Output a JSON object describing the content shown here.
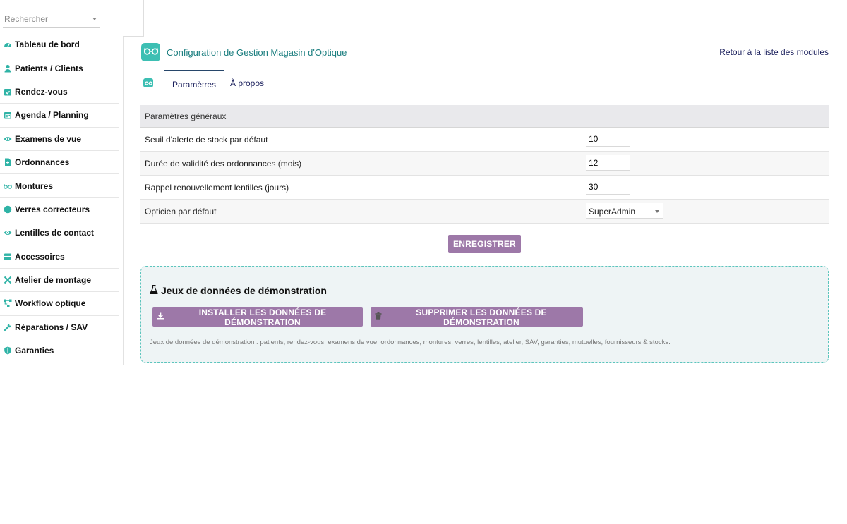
{
  "sidebar": {
    "search_placeholder": "Rechercher",
    "items": [
      {
        "label": "Tableau de bord",
        "icon": "dashboard-icon"
      },
      {
        "label": "Patients / Clients",
        "icon": "user-icon"
      },
      {
        "label": "Rendez-vous",
        "icon": "calendar-check-icon"
      },
      {
        "label": "Agenda / Planning",
        "icon": "calendar-icon"
      },
      {
        "label": "Examens de vue",
        "icon": "eye-icon"
      },
      {
        "label": "Ordonnances",
        "icon": "prescription-file-icon"
      },
      {
        "label": "Montures",
        "icon": "glasses-icon"
      },
      {
        "label": "Verres correcteurs",
        "icon": "circle-icon"
      },
      {
        "label": "Lentilles de contact",
        "icon": "eye-icon"
      },
      {
        "label": "Accessoires",
        "icon": "box-icon"
      },
      {
        "label": "Atelier de montage",
        "icon": "tools-icon"
      },
      {
        "label": "Workflow optique",
        "icon": "workflow-icon"
      },
      {
        "label": "Réparations / SAV",
        "icon": "wrench-icon"
      },
      {
        "label": "Garanties",
        "icon": "shield-icon"
      }
    ]
  },
  "header": {
    "title": "Configuration de Gestion Magasin d'Optique",
    "back_link": "Retour à la liste des modules",
    "logo_icon": "glasses-icon"
  },
  "tabs": [
    {
      "label": "Paramètres",
      "active": true
    },
    {
      "label": "À propos",
      "active": false
    }
  ],
  "params": {
    "header": "Paramètres généraux",
    "rows": [
      {
        "label": "Seuil d'alerte de stock par défaut",
        "value": "10"
      },
      {
        "label": "Durée de validité des ordonnances (mois)",
        "value": "12"
      },
      {
        "label": "Rappel renouvellement lentilles (jours)",
        "value": "30"
      },
      {
        "label": "Opticien par défaut",
        "value": "SuperAdmin"
      }
    ],
    "save_label": "ENREGISTRER"
  },
  "demo": {
    "title": "Jeux de données de démonstration",
    "install_label": "INSTALLER LES DONNÉES DE DÉMONSTRATION",
    "delete_label": "SUPPRIMER LES DONNÉES DE DÉMONSTRATION",
    "note": "Jeux de données de démonstration : patients, rendez-vous, examens de vue, ordonnances, montures, verres, lentilles, atelier, SAV, garanties, mutuelles, fournisseurs & stocks."
  },
  "colors": {
    "accent_teal": "#3dbfb3",
    "button_purple": "#9d78a8",
    "link_navy": "#1a1f5c",
    "title_teal": "#1d7f80"
  }
}
